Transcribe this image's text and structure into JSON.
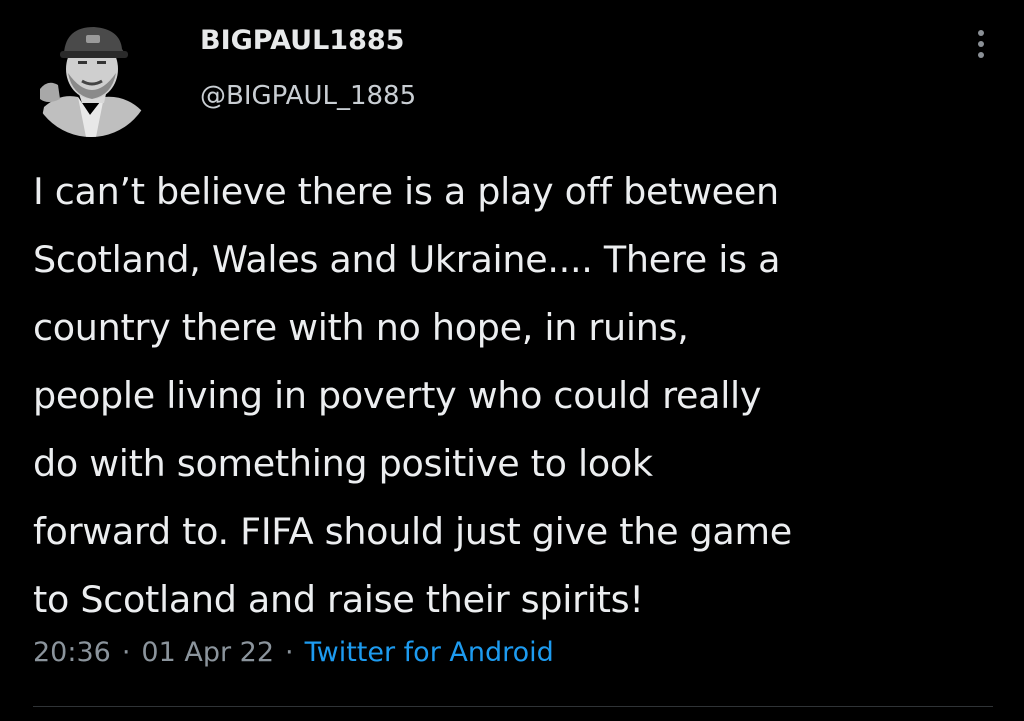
{
  "tweet": {
    "display_name": "BIGPAUL1885",
    "handle": "@BIGPAUL_1885",
    "text": "I can’t believe there is a play off between\nScotland, Wales and Ukraine.... There is a\ncountry there with no hope, in ruins,\npeople living in poverty who could really\ndo with something positive to look\nforward to. FIFA should just give the game\nto Scotland and raise their spirits!",
    "time": "20:36",
    "date": "01 Apr 22",
    "separator": "·",
    "source": "Twitter for Android",
    "avatar_icon": "profile-photo",
    "more_icon": "vertical-ellipsis-icon"
  },
  "colors": {
    "background": "#000000",
    "text": "#e7e9ea",
    "secondary": "#8b949c",
    "link": "#1d9bf0"
  }
}
